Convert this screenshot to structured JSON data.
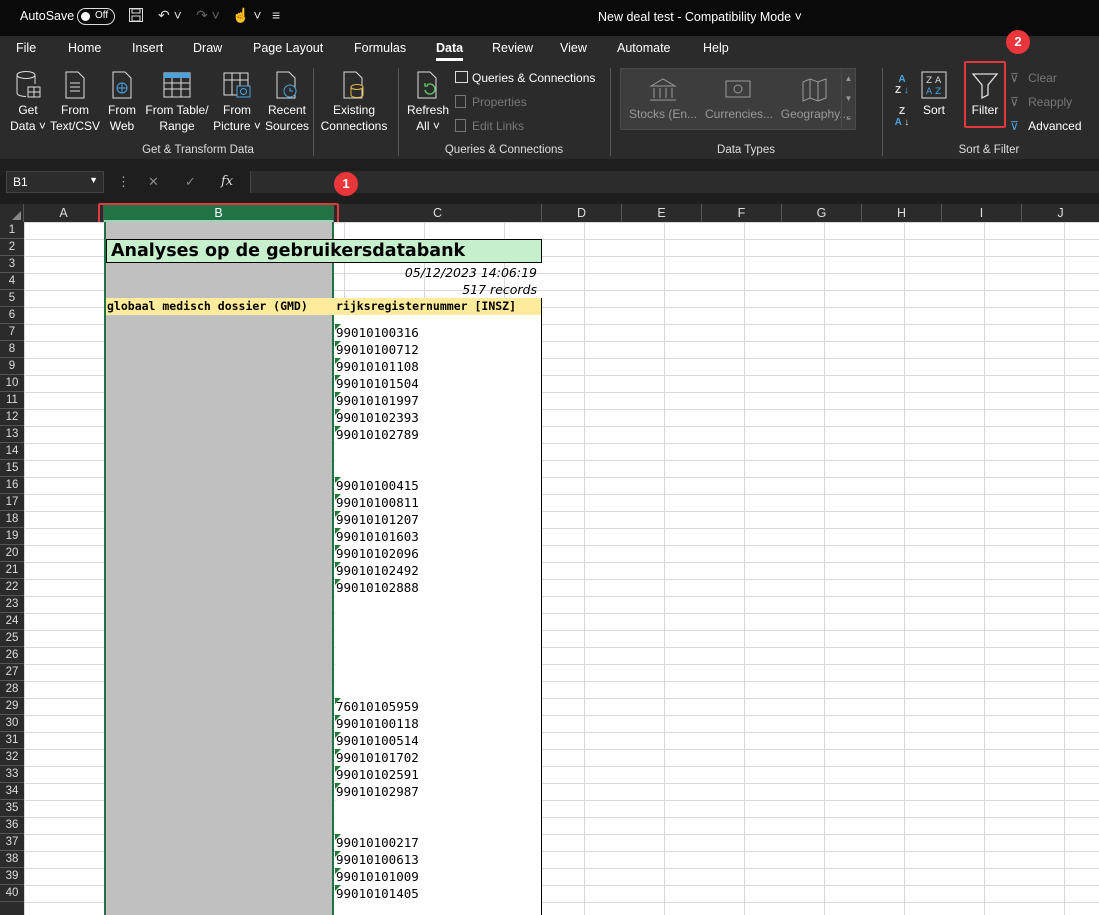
{
  "titlebar": {
    "autosave": "AutoSave",
    "toggle": "Off",
    "title": "New deal test  -  Compatibility Mode"
  },
  "menu": [
    "File",
    "Home",
    "Insert",
    "Draw",
    "Page Layout",
    "Formulas",
    "Data",
    "Review",
    "View",
    "Automate",
    "Help"
  ],
  "menu_active": "Data",
  "ribbon": {
    "get_data": "Get Data",
    "from_text": "From Text/CSV",
    "from_web": "From Web",
    "from_table": "From Table/ Range",
    "from_picture": "From Picture",
    "recent_sources": "Recent Sources",
    "existing_connections": "Existing Connections",
    "group_get_transform": "Get & Transform Data",
    "refresh_all": "Refresh All",
    "queries_connections": "Queries & Connections",
    "properties": "Properties",
    "edit_links": "Edit Links",
    "group_queries": "Queries & Connections",
    "stocks": "Stocks (En...",
    "currencies": "Currencies...",
    "geography": "Geography...",
    "group_data_types": "Data Types",
    "sort": "Sort",
    "filter": "Filter",
    "clear": "Clear",
    "reapply": "Reapply",
    "advanced": "Advanced",
    "group_sort_filter": "Sort & Filter"
  },
  "badges": {
    "one": "1",
    "two": "2"
  },
  "formula_bar": {
    "name_box": "B1",
    "fx": "fx",
    "formula": ""
  },
  "columns": [
    "A",
    "B",
    "C",
    "D",
    "E",
    "F",
    "G",
    "H",
    "I",
    "J"
  ],
  "rows": [
    "1",
    "2",
    "3",
    "4",
    "5",
    "6",
    "7",
    "8",
    "9",
    "10",
    "11",
    "12",
    "13",
    "14",
    "15",
    "16",
    "17",
    "18",
    "19",
    "20",
    "21",
    "22",
    "23",
    "24",
    "25",
    "26",
    "27",
    "28",
    "29",
    "30",
    "31",
    "32",
    "33",
    "34",
    "35",
    "36",
    "37",
    "38",
    "39",
    "40"
  ],
  "sheet": {
    "title": "Analyses op de gebruikersdatabank",
    "timestamp": "05/12/2023 14:06:19",
    "records": "517 records",
    "header_b": "globaal medisch dossier (GMD)",
    "header_c": "rijksregisternummer [INSZ]",
    "values": [
      {
        "row": 7,
        "v": "99010100316"
      },
      {
        "row": 8,
        "v": "99010100712"
      },
      {
        "row": 9,
        "v": "99010101108"
      },
      {
        "row": 10,
        "v": "99010101504"
      },
      {
        "row": 11,
        "v": "99010101997"
      },
      {
        "row": 12,
        "v": "99010102393"
      },
      {
        "row": 13,
        "v": "99010102789"
      },
      {
        "row": 16,
        "v": "99010100415"
      },
      {
        "row": 17,
        "v": "99010100811"
      },
      {
        "row": 18,
        "v": "99010101207"
      },
      {
        "row": 19,
        "v": "99010101603"
      },
      {
        "row": 20,
        "v": "99010102096"
      },
      {
        "row": 21,
        "v": "99010102492"
      },
      {
        "row": 22,
        "v": "99010102888"
      },
      {
        "row": 29,
        "v": "76010105959"
      },
      {
        "row": 30,
        "v": "99010100118"
      },
      {
        "row": 31,
        "v": "99010100514"
      },
      {
        "row": 32,
        "v": "99010101702"
      },
      {
        "row": 33,
        "v": "99010102591"
      },
      {
        "row": 34,
        "v": "99010102987"
      },
      {
        "row": 37,
        "v": "99010100217"
      },
      {
        "row": 38,
        "v": "99010100613"
      },
      {
        "row": 39,
        "v": "99010101009"
      },
      {
        "row": 40,
        "v": "99010101405"
      }
    ]
  },
  "colors": {
    "accent": "#217346",
    "highlight": "#e0393e",
    "title_fill": "#c6efce",
    "header_fill": "#ffeb9c",
    "gray_fill": "#c0c0c0"
  }
}
